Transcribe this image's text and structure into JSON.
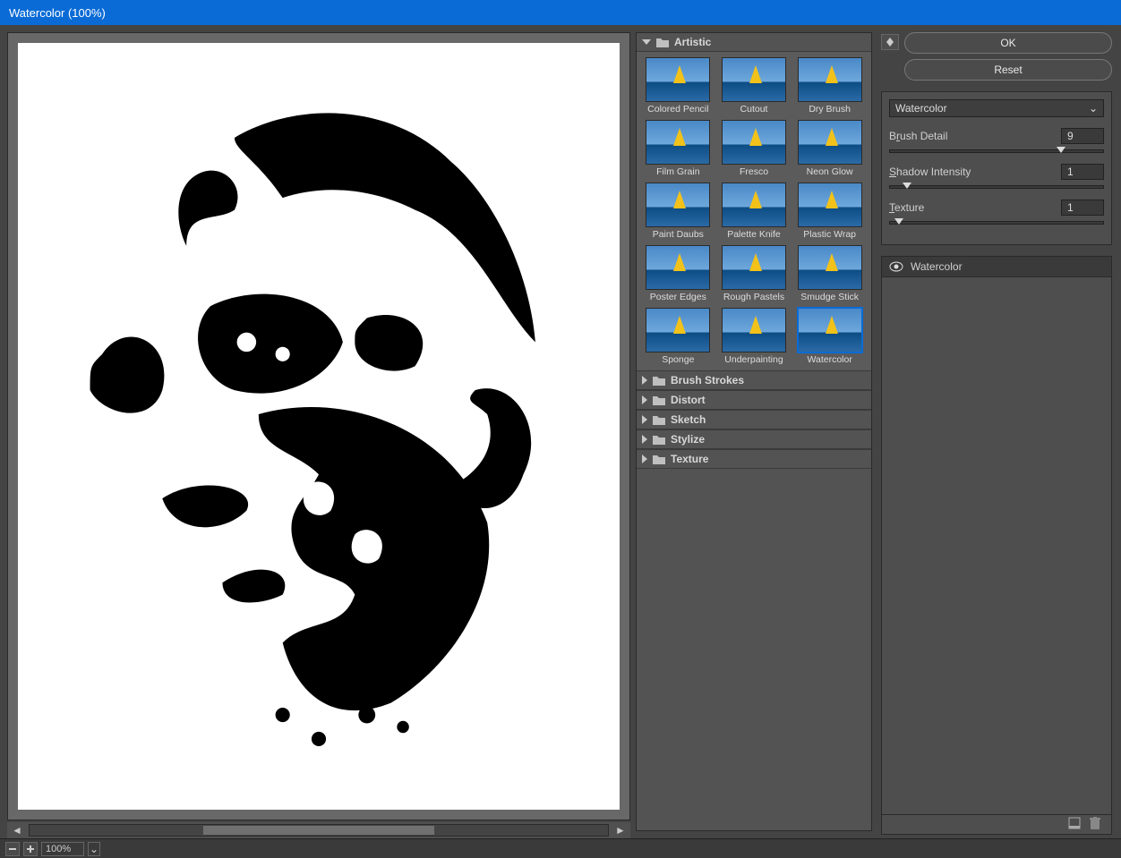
{
  "title": "Watercolor (100%)",
  "zoom_value": "100%",
  "buttons": {
    "ok": "OK",
    "reset": "Reset"
  },
  "categories": {
    "expanded": {
      "name": "Artistic",
      "filters": [
        "Colored Pencil",
        "Cutout",
        "Dry Brush",
        "Film Grain",
        "Fresco",
        "Neon Glow",
        "Paint Daubs",
        "Palette Knife",
        "Plastic Wrap",
        "Poster Edges",
        "Rough Pastels",
        "Smudge Stick",
        "Sponge",
        "Underpainting",
        "Watercolor"
      ],
      "selected": "Watercolor"
    },
    "collapsed": [
      "Brush Strokes",
      "Distort",
      "Sketch",
      "Stylize",
      "Texture"
    ]
  },
  "dropdown": {
    "value": "Watercolor"
  },
  "params": [
    {
      "label_pre": "B",
      "label_u": "r",
      "label_post": "ush Detail",
      "value": "9",
      "handle_pct": 78
    },
    {
      "label_pre": "",
      "label_u": "S",
      "label_post": "hadow Intensity",
      "value": "1",
      "handle_pct": 6
    },
    {
      "label_pre": "",
      "label_u": "T",
      "label_post": "exture",
      "value": "1",
      "handle_pct": 2
    }
  ],
  "layer": {
    "name": "Watercolor"
  }
}
